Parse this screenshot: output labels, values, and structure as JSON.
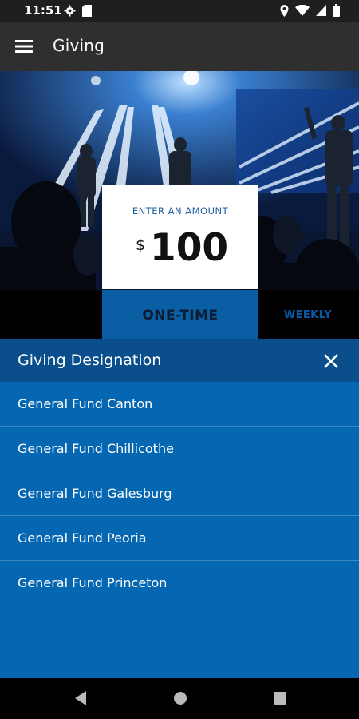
{
  "status_bar": {
    "time": "11:51",
    "icons": [
      "gear-icon",
      "sd-card-icon",
      "location-icon",
      "wifi-icon",
      "signal-icon",
      "battery-icon"
    ]
  },
  "app_bar": {
    "title": "Giving",
    "menu_icon": "hamburger-menu-icon"
  },
  "giving": {
    "amount_label": "ENTER AN AMOUNT",
    "currency_symbol": "$",
    "amount": "100",
    "frequency_tabs": [
      "ONE-TIME",
      "WEEKLY"
    ],
    "selected_tab": "ONE-TIME"
  },
  "designation_sheet": {
    "title": "Giving Designation",
    "close_icon": "close-icon",
    "items": [
      {
        "label": "General Fund Canton"
      },
      {
        "label": "General Fund Chillicothe"
      },
      {
        "label": "General Fund Galesburg"
      },
      {
        "label": "General Fund Peoria"
      },
      {
        "label": "General Fund Princeton"
      }
    ]
  },
  "nav_bar": {
    "icons": [
      "back-icon",
      "home-icon",
      "recents-icon"
    ]
  },
  "colors": {
    "accent": "#0566b2",
    "sheet_header": "#0a4f8c",
    "app_bar": "#2f2f2f",
    "status_bar": "#1f1f1f",
    "tab_text": "#0b5aa6"
  }
}
